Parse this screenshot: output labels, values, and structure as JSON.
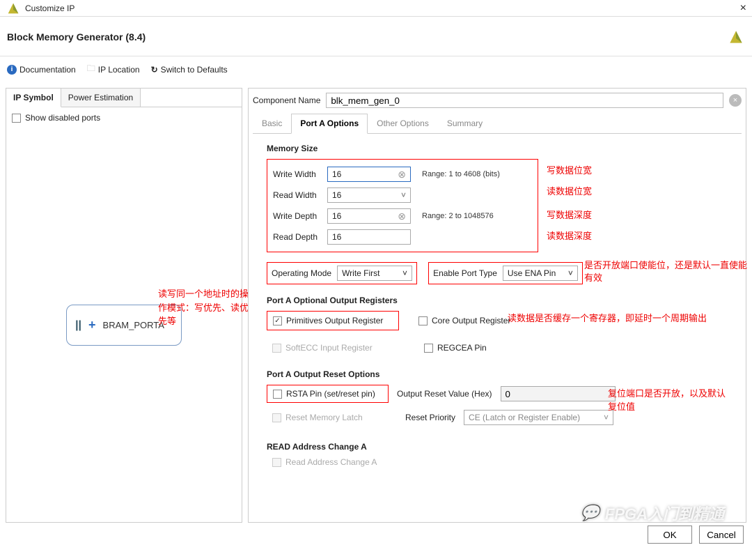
{
  "window": {
    "title": "Customize IP",
    "close": "×"
  },
  "header": {
    "title": "Block Memory Generator (8.4)"
  },
  "toolbar": {
    "documentation": "Documentation",
    "ip_location": "IP Location",
    "switch_defaults": "Switch to Defaults"
  },
  "left": {
    "tabs": [
      "IP Symbol",
      "Power Estimation"
    ],
    "active_tab": 0,
    "show_disabled_label": "Show disabled ports",
    "bram_label": "BRAM_PORTA"
  },
  "comp_name": {
    "label": "Component Name",
    "value": "blk_mem_gen_0"
  },
  "right_tabs": [
    "Basic",
    "Port A Options",
    "Other Options",
    "Summary"
  ],
  "right_active": 1,
  "memsize": {
    "title": "Memory Size",
    "write_width": {
      "label": "Write Width",
      "value": "16",
      "range": "Range: 1 to 4608 (bits)"
    },
    "read_width": {
      "label": "Read Width",
      "value": "16"
    },
    "write_depth": {
      "label": "Write Depth",
      "value": "16",
      "range": "Range: 2 to 1048576"
    },
    "read_depth": {
      "label": "Read Depth",
      "value": "16"
    }
  },
  "opmode": {
    "label": "Operating Mode",
    "value": "Write First"
  },
  "enable_port": {
    "label": "Enable Port Type",
    "value": "Use ENA Pin"
  },
  "opt_reg": {
    "title": "Port A Optional Output Registers",
    "primitives": "Primitives Output Register",
    "core": "Core Output Register",
    "softecc": "SoftECC Input Register",
    "regcea": "REGCEA Pin"
  },
  "reset_opt": {
    "title": "Port A Output Reset Options",
    "rsta": "RSTA Pin (set/reset pin)",
    "orv_label": "Output Reset Value (Hex)",
    "orv_value": "0",
    "rml": "Reset Memory Latch",
    "prio_label": "Reset Priority",
    "prio_value": "CE (Latch or Register Enable)"
  },
  "read_addr": {
    "title": "READ Address Change A",
    "opt": "Read Address Change A"
  },
  "footer": {
    "ok": "OK",
    "cancel": "Cancel"
  },
  "annotations": {
    "ww": "写数据位宽",
    "rw": "读数据位宽",
    "wd": "写数据深度",
    "rd": "读数据深度",
    "opmode": "读写同一个地址时的操作模式：写优先、读优先等",
    "enable": "是否开放端口使能位，还是默认一直使能有效",
    "optreg": "读数据是否缓存一个寄存器，即延时一个周期输出",
    "reset": "复位端口是否开放，以及默认复位值"
  },
  "watermark": "FPGA入门到精通"
}
